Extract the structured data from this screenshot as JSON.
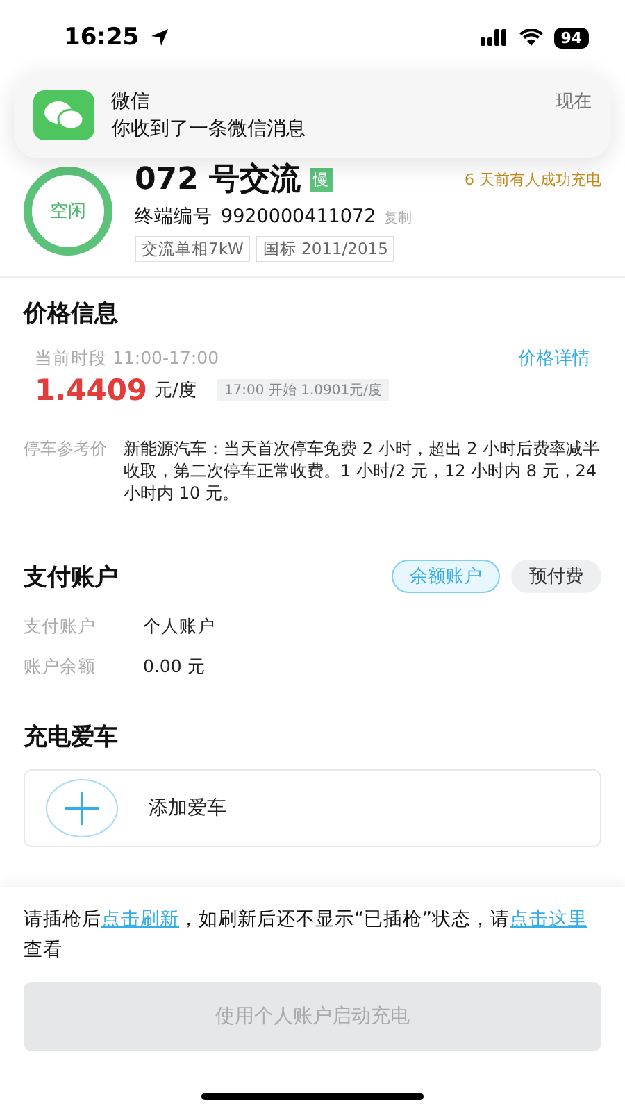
{
  "status_bar": {
    "time": "16:25",
    "battery": "94"
  },
  "notification": {
    "app": "微信",
    "message": "你收到了一条微信消息",
    "time": "现在"
  },
  "station": {
    "status": "空闲",
    "name": "072 号交流",
    "speed": "慢",
    "recent": "6 天前有人成功充电",
    "terminal_label": "终端编号",
    "terminal_no": "9920000411072",
    "copy": "复制",
    "tags": [
      "交流单相7kW",
      "国标 2011/2015"
    ]
  },
  "price": {
    "title": "价格信息",
    "period": "当前时段 11:00-17:00",
    "details_link": "价格详情",
    "amount": "1.4409",
    "unit": "元/度",
    "next": "17:00 开始 1.0901元/度",
    "parking_label": "停车参考价",
    "parking_text": "新能源汽车：当天首次停车免费 2 小时，超出 2 小时后费率减半收取，第二次停车正常收费。1 小时/2 元，12 小时内 8 元，24 小时内 10 元。"
  },
  "payment": {
    "title": "支付账户",
    "options": [
      {
        "label": "余额账户",
        "selected": true
      },
      {
        "label": "预付费",
        "selected": false
      }
    ],
    "rows": [
      {
        "label": "支付账户",
        "value": "个人账户"
      },
      {
        "label": "账户余额",
        "value": "0.00 元"
      }
    ]
  },
  "car": {
    "title": "充电爱车",
    "add": "添加爱车"
  },
  "footer": {
    "text_parts": [
      {
        "kind": "text",
        "text": "请插枪后"
      },
      {
        "kind": "link",
        "text": "点击刷新"
      },
      {
        "kind": "text",
        "text": "，如刷新后还不显示“已插枪”状态，请"
      },
      {
        "kind": "link",
        "text": "点击这里"
      },
      {
        "kind": "text",
        "text": "查看"
      }
    ],
    "button": {
      "label": "使用个人账户启动充电",
      "disabled": true
    }
  }
}
